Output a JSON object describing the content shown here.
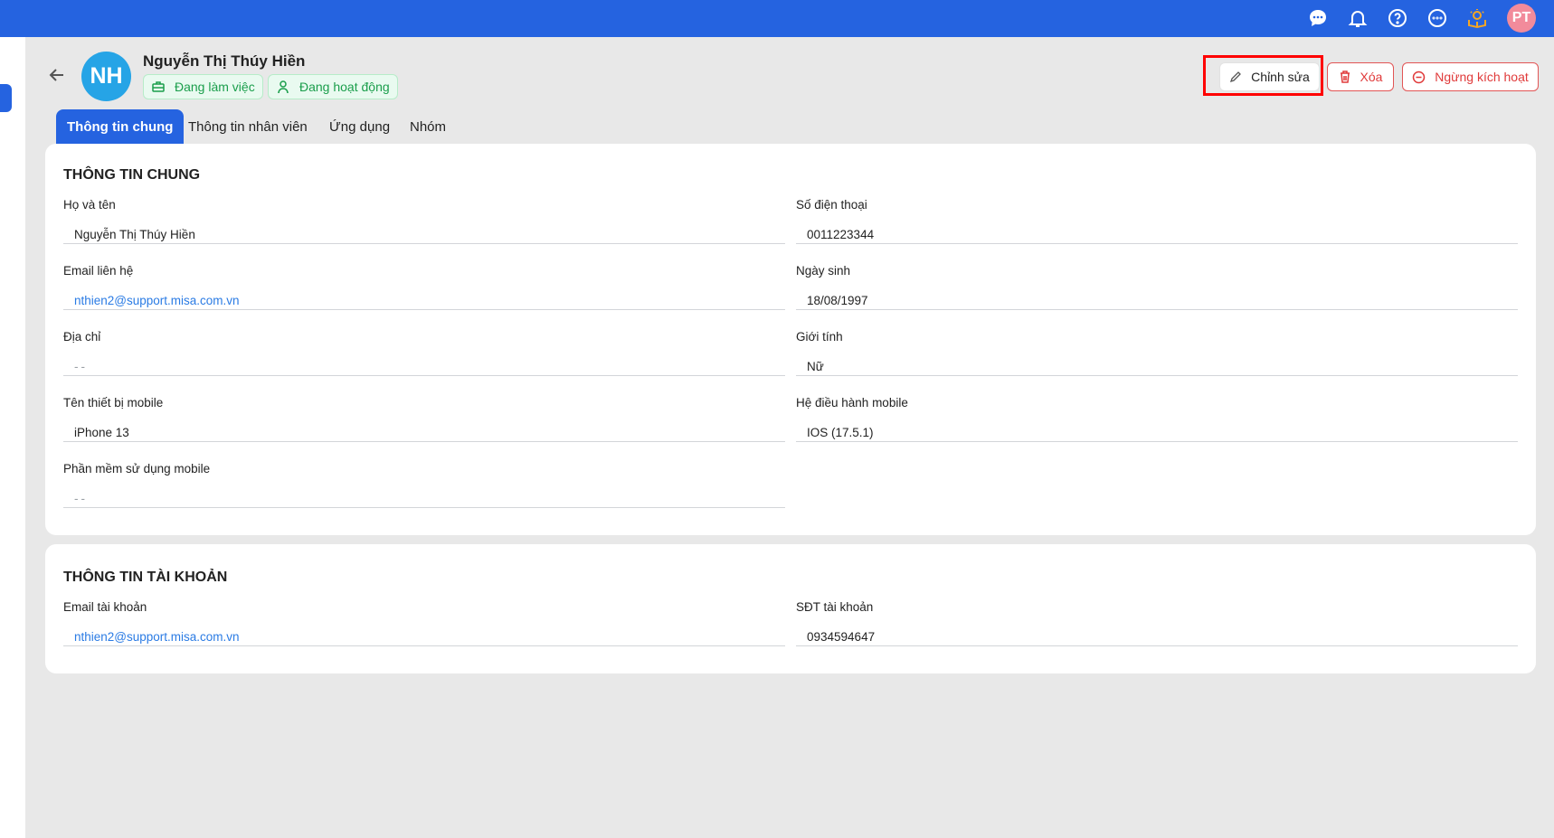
{
  "topbar": {
    "icons": [
      "chat-icon",
      "bell-icon",
      "help-icon",
      "more-icon",
      "idea-book-icon"
    ],
    "user_initials": "PT"
  },
  "profile": {
    "initials": "NH",
    "name": "Nguyễn Thị Thúy Hiền",
    "badges": [
      "Đang làm việc",
      "Đang hoạt động"
    ]
  },
  "actions": {
    "edit": "Chỉnh sửa",
    "delete": "Xóa",
    "deactivate": "Ngừng kích hoạt"
  },
  "tabs": [
    "Thông tin chung",
    "Thông tin nhân viên",
    "Ứng dụng",
    "Nhóm"
  ],
  "general": {
    "title": "THÔNG TIN CHUNG",
    "fields": [
      {
        "label": "Họ và tên",
        "value": "Nguyễn Thị Thúy Hiền"
      },
      {
        "label": "Số điện thoại",
        "value": "0011223344"
      },
      {
        "label": "Email liên hệ",
        "value": "nthien2@support.misa.com.vn"
      },
      {
        "label": "Ngày sinh",
        "value": "18/08/1997"
      },
      {
        "label": "Địa chỉ",
        "value": "--"
      },
      {
        "label": "Giới tính",
        "value": "Nữ"
      },
      {
        "label": "Tên thiết bị mobile",
        "value": "iPhone 13"
      },
      {
        "label": "Hệ điều hành mobile",
        "value": "IOS (17.5.1)"
      },
      {
        "label": "Phần mềm sử dụng mobile",
        "value": "--"
      }
    ]
  },
  "account": {
    "title": "THÔNG TIN TÀI KHOẢN",
    "fields": [
      {
        "label": "Email tài khoản",
        "value": "nthien2@support.misa.com.vn"
      },
      {
        "label": "SĐT tài khoản",
        "value": "0934594647"
      }
    ]
  }
}
